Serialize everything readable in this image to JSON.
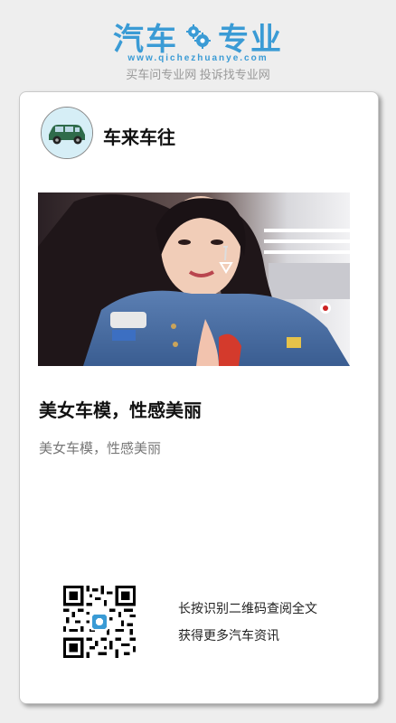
{
  "header": {
    "brand_left": "汽车",
    "brand_right": "专业",
    "brand_url": "www.qichezhuanye.com",
    "slogan": "买车问专业网 投诉找专业网"
  },
  "card": {
    "author_name": "车来车往",
    "article_title": "美女车模，性感美丽",
    "article_summary": "美女车模，性感美丽",
    "qr_prompt_line1": "长按识别二维码查阅全文",
    "qr_prompt_line2": "获得更多汽车资讯"
  },
  "colors": {
    "brand": "#3a9bd5",
    "background": "#eeeeee",
    "card": "#ffffff"
  },
  "icons": {
    "brand_logo": "gear-icon",
    "avatar": "car-icon",
    "photo": "photo-model",
    "qr": "qr-code-icon"
  }
}
